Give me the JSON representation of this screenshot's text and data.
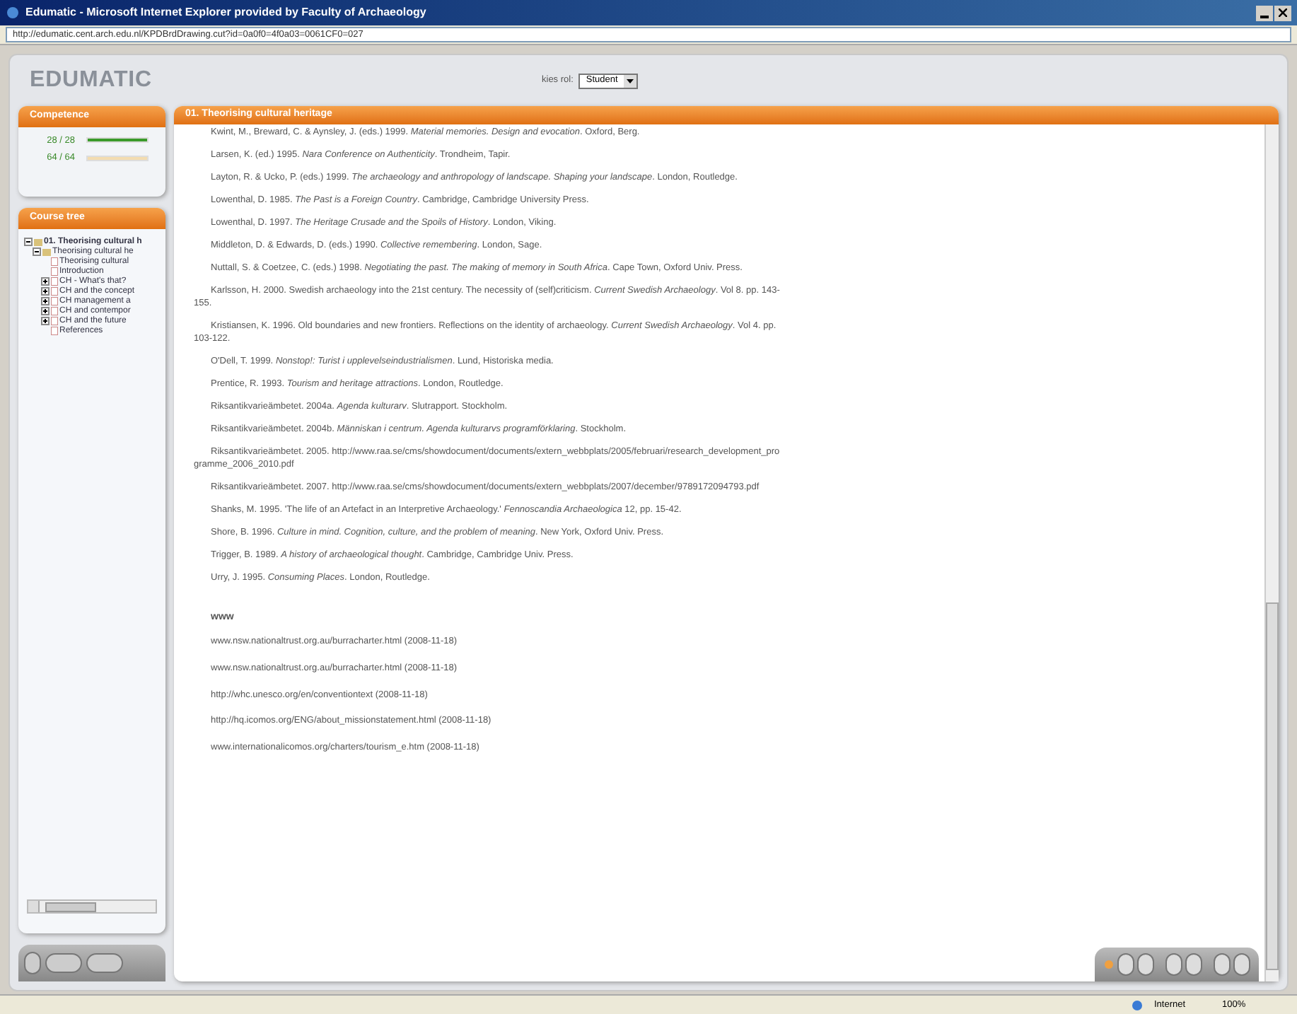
{
  "window": {
    "title": "Edumatic - Microsoft Internet Explorer provided by Faculty of Archaeology",
    "address": "http://edumatic.cent.arch.edu.nl/KPDBrdDrawing.cut?id=0a0f0=4f0a03=0061CF0=027"
  },
  "header": {
    "logo": "EDUMATIC",
    "role_label": "kies rol:",
    "role_value": "Student"
  },
  "competence": {
    "title": "Competence",
    "meters": [
      {
        "reading": "28 / 28",
        "level": 1,
        "color": "#3a9a2a"
      },
      {
        "reading": "64 / 64",
        "level": 1,
        "color": "#f3dcb0"
      }
    ]
  },
  "course_tree": {
    "title": "Course tree",
    "items": [
      {
        "label": "01. Theorising cultural h",
        "expanded": true,
        "children": [
          {
            "label": "Theorising cultural he",
            "expanded": true,
            "children": [
              {
                "label": "Theorising cultural"
              },
              {
                "label": "Introduction"
              },
              {
                "label": "CH - What's that?",
                "expanded": false
              },
              {
                "label": "CH and the concept",
                "expanded": false
              },
              {
                "label": "CH management a",
                "expanded": false
              },
              {
                "label": "CH and contempor",
                "expanded": false
              },
              {
                "label": "CH and the future",
                "expanded": false
              },
              {
                "label": "References"
              }
            ]
          }
        ]
      }
    ]
  },
  "content": {
    "title": "01. Theorising cultural heritage",
    "references": [
      "Kwint, M., Breward, C. & Aynsley, J. (eds.) 1999. *Material memories. Design and evocation*. Oxford, Berg.",
      "Larsen, K. (ed.) 1995. *Nara Conference on Authenticity*. Trondheim, Tapir.",
      "Layton, R. & Ucko, P. (eds.) 1999. *The archaeology and anthropology of landscape. Shaping your landscape*. London, Routledge.",
      "Lowenthal, D. 1985. *The Past is a Foreign Country*. Cambridge, Cambridge University Press.",
      "Lowenthal, D. 1997. *The Heritage Crusade and the Spoils of History*. London, Viking.",
      "Middleton, D. & Edwards, D. (eds.) 1990. *Collective remembering*. London, Sage.",
      "Nuttall, S. & Coetzee, C. (eds.) 1998. *Negotiating the past. The making of memory in South Africa*. Cape Town, Oxford Univ. Press.",
      "Karlsson, H. 2000. Swedish archaeology into the 21st century. The necessity of (self)criticism. *Current Swedish Archaeology*. Vol 8. pp. 143-155.",
      "Kristiansen, K. 1996. Old boundaries and new frontiers. Reflections on the identity of archaeology. *Current Swedish Archaeology*. Vol 4. pp. 103-122.",
      "O'Dell, T. 1999. *Nonstop!: Turist i upplevelseindustrialismen*. Lund, Historiska media.",
      "Prentice, R. 1993. *Tourism and heritage attractions*. London, Routledge.",
      "Riksantikvarieämbetet. 2004a. *Agenda kulturarv*. Slutrapport. Stockholm.",
      "Riksantikvarieämbetet. 2004b. *Människan i centrum. Agenda kulturarvs programförklaring*. Stockholm.",
      "Riksantikvarieämbetet. 2005. http://www.raa.se/cms/showdocument/documents/extern_webbplats/2005/februari/research_development_programme_2006_2010.pdf",
      "Riksantikvarieämbetet. 2007. http://www.raa.se/cms/showdocument/documents/extern_webbplats/2007/december/9789172094793.pdf",
      "Shanks, M. 1995. 'The life of an Artefact in an Interpretive Archaeology.' *Fennoscandia Archaeologica* 12, pp. 15-42.",
      "Shore, B. 1996. *Culture in mind. Cognition, culture, and the problem of meaning*. New York, Oxford Univ. Press.",
      "Trigger, B. 1989. *A history of archaeological thought*. Cambridge, Cambridge Univ. Press.",
      "Urry, J. 1995. *Consuming Places*. London, Routledge."
    ],
    "links_heading": "www",
    "links": [
      "www.nsw.nationaltrust.org.au/burracharter.html (2008-11-18)",
      "www.nsw.nationaltrust.org.au/burracharter.html (2008-11-18)",
      "http://whc.unesco.org/en/conventiontext (2008-11-18)",
      "http://hq.icomos.org/ENG/about_missionstatement.html (2008-11-18)",
      "www.internationalicomos.org/charters/tourism_e.htm (2008-11-18)"
    ]
  },
  "status_bar": {
    "zone": "Internet",
    "zoom": "100%"
  }
}
